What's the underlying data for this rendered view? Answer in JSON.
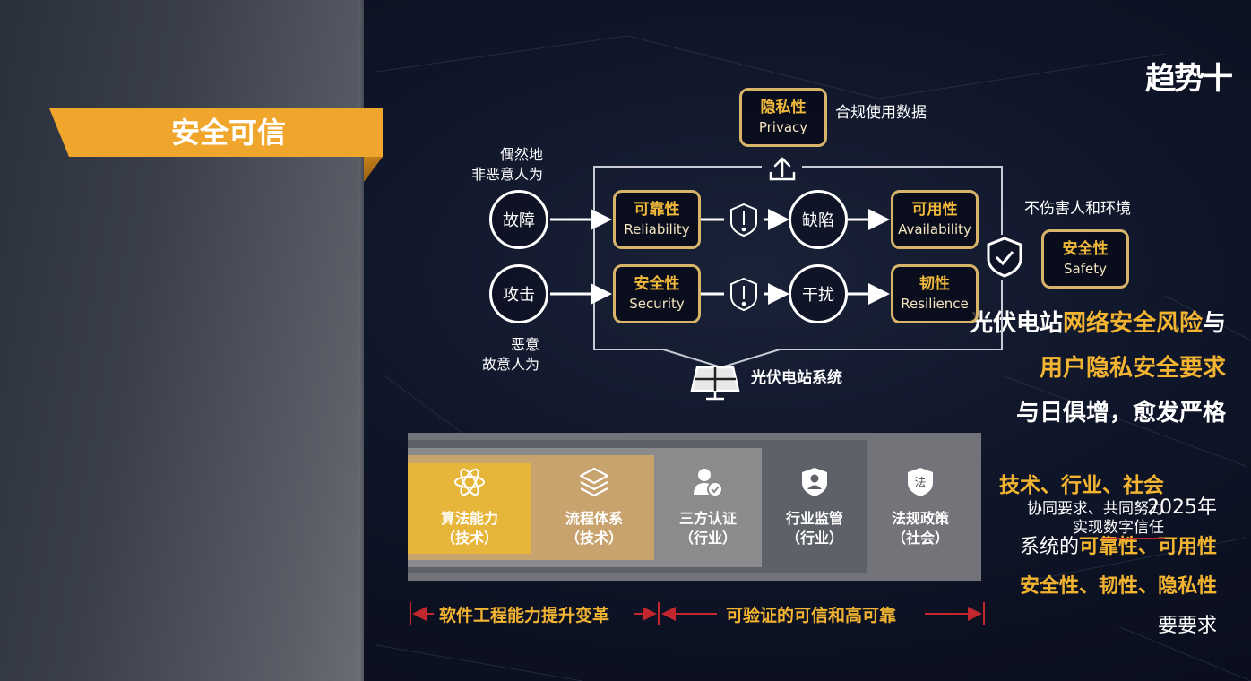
{
  "left": {
    "trend_title": "趋势十",
    "banner": "安全可信",
    "headline": [
      {
        "plain": "光伏电站",
        "highlight": "网络安全风险",
        "tail": "与"
      },
      {
        "plain": "",
        "highlight": "用户隐私安全要求",
        "tail": ""
      },
      {
        "plain": "与日俱增，愈发严格",
        "highlight": "",
        "tail": ""
      }
    ],
    "year": "2025年",
    "sub_line1_plain": "系统的",
    "sub_line1_hl": "可靠性、可用性",
    "sub_line2_hl": "安全性、韧性、隐私性",
    "sub_line3": "要要求"
  },
  "diagram": {
    "privacy": {
      "cn": "隐私性",
      "en": "Privacy",
      "note": "合规使用数据"
    },
    "fault_note": [
      "偶然地",
      "非恶意人为"
    ],
    "attack_note": [
      "恶意",
      "故意人为"
    ],
    "circles": {
      "fault": "故障",
      "attack": "攻击",
      "defect": "缺陷",
      "interference": "干扰"
    },
    "reliability": {
      "cn": "可靠性",
      "en": "Reliability"
    },
    "security": {
      "cn": "安全性",
      "en": "Security"
    },
    "availability": {
      "cn": "可用性",
      "en": "Availability"
    },
    "resilience": {
      "cn": "韧性",
      "en": "Resilience"
    },
    "safety": {
      "cn": "安全性",
      "en": "Safety",
      "note": "不伤害人和环境"
    },
    "system_label": "光伏电站系统",
    "icons": [
      "upload-icon",
      "shield-alert-icon",
      "shield-check-icon",
      "solar-panel-icon"
    ]
  },
  "pillars": [
    {
      "name": "算法能力",
      "scope": "（技术）",
      "icon": "atom-icon",
      "color": "#e6b63b"
    },
    {
      "name": "流程体系",
      "scope": "（技术）",
      "icon": "layers-icon",
      "color": "#c8a36d"
    },
    {
      "name": "三方认证",
      "scope": "（行业）",
      "icon": "user-check-icon",
      "color": "#8b8b8d"
    },
    {
      "name": "行业监管",
      "scope": "（行业）",
      "icon": "shield-user-icon",
      "color": "#5f6169"
    },
    {
      "name": "法规政策",
      "scope": "（社会）",
      "icon": "shield-law-icon",
      "color": "#737479"
    }
  ],
  "right_note": {
    "title": "技术、行业、社会",
    "line1": "协同要求、共同努力",
    "line2": "实现数字信任"
  },
  "ranges": {
    "left": "软件工程能力提升变革",
    "right": "可验证的可信和高可靠"
  },
  "colors": {
    "accent": "#f0a62c",
    "gold": "#f3b531",
    "red": "#c0282d"
  }
}
